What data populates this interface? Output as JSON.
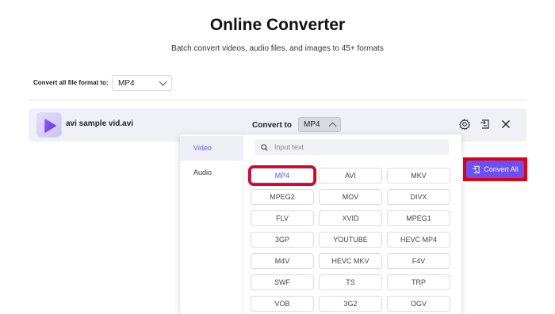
{
  "header": {
    "title": "Online Converter",
    "subtitle": "Batch convert videos, audio files, and images to 45+ formats"
  },
  "global_format": {
    "label": "Convert all file format to:",
    "value": "MP4"
  },
  "file": {
    "name": "avi sample vid.avi",
    "convert_to_label": "Convert to",
    "selected_format": "MP4"
  },
  "dropdown": {
    "categories": [
      {
        "label": "Video",
        "active": true
      },
      {
        "label": "Audio",
        "active": false
      }
    ],
    "search_placeholder": "Input text",
    "formats": [
      [
        "MP4",
        "AVI",
        "MKV"
      ],
      [
        "MPEG2",
        "MOV",
        "DIVX"
      ],
      [
        "FLV",
        "XVID",
        "MPEG1"
      ],
      [
        "3GP",
        "YOUTUBE",
        "HEVC MP4"
      ],
      [
        "M4V",
        "HEVC MKV",
        "F4V"
      ],
      [
        "SWF",
        "TS",
        "TRP"
      ],
      [
        "VOB",
        "3G2",
        "OGV"
      ]
    ],
    "selected": "MP4"
  },
  "actions": {
    "convert_all_label": "Convert All"
  },
  "colors": {
    "accent": "#6a4ff5",
    "highlight": "#e0000f"
  }
}
